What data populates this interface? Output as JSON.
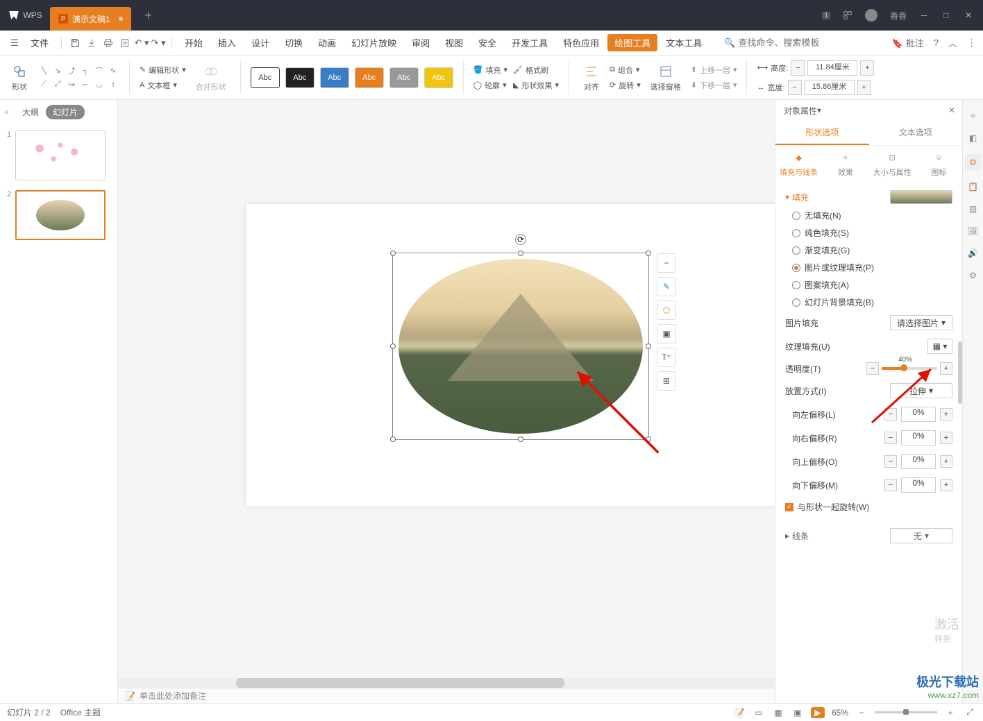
{
  "titlebar": {
    "app": "WPS",
    "tab_name": "演示文稿1",
    "badge": "1",
    "user": "香香"
  },
  "menubar": {
    "file": "文件",
    "items": [
      "开始",
      "插入",
      "设计",
      "切换",
      "动画",
      "幻灯片放映",
      "审阅",
      "视图",
      "安全",
      "开发工具",
      "特色应用",
      "绘图工具",
      "文本工具"
    ],
    "active_tool_index": 11,
    "search_placeholder": "查找命令、搜索模板",
    "annotate": "批注"
  },
  "ribbon": {
    "shape": "形状",
    "edit_shape": "编辑形状",
    "text_box": "文本框",
    "merge_shape": "合并形状",
    "swatch_label": "Abc",
    "fill": "填充",
    "outline": "轮廓",
    "format_painter": "格式刷",
    "shape_effect": "形状效果",
    "align": "对齐",
    "group": "组合",
    "rotate": "旋转",
    "select_pane": "选择窗格",
    "bring_forward": "上移一层",
    "send_backward": "下移一层",
    "height_label": "高度:",
    "height_value": "11.84厘米",
    "width_label": "宽度:",
    "width_value": "15.86厘米"
  },
  "left": {
    "outline": "大纲",
    "slides": "幻灯片"
  },
  "canvas": {
    "notes_placeholder": "单击此处添加备注"
  },
  "right": {
    "title": "对象属性",
    "tab_shape": "形状选项",
    "tab_text": "文本选项",
    "sub_fill": "填充与线条",
    "sub_effect": "效果",
    "sub_size": "大小与属性",
    "sub_icon": "图标",
    "section_fill": "填充",
    "fill_none": "无填充(N)",
    "fill_solid": "纯色填充(S)",
    "fill_gradient": "渐变填充(G)",
    "fill_picture": "图片或纹理填充(P)",
    "fill_pattern": "图案填充(A)",
    "fill_slide_bg": "幻灯片背景填充(B)",
    "picture_fill": "图片填充",
    "picture_fill_value": "请选择图片",
    "texture_fill": "纹理填充(U)",
    "transparency": "透明度(T)",
    "transparency_value": "40%",
    "tile_mode": "放置方式(I)",
    "tile_mode_value": "拉伸",
    "offset_left": "向左偏移(L)",
    "offset_right": "向右偏移(R)",
    "offset_top": "向上偏移(O)",
    "offset_bottom": "向下偏移(M)",
    "offset_value": "0%",
    "rotate_with_shape": "与形状一起旋转(W)",
    "section_line": "线条",
    "line_value": "无"
  },
  "statusbar": {
    "slide_info": "幻灯片 2 / 2",
    "theme": "Office 主题",
    "zoom": "65%"
  },
  "watermark": {
    "line1": "极光下载站",
    "line2": "www.xz7.com"
  },
  "activation": {
    "line1": "激活",
    "line2": "转到"
  }
}
